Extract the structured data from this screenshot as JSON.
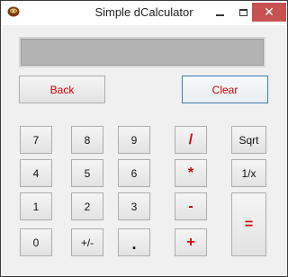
{
  "window": {
    "title": "Simple dCalculator",
    "close_glyph": "✕"
  },
  "display": {
    "value": ""
  },
  "top_buttons": {
    "back": "Back",
    "clear": "Clear"
  },
  "keypad": {
    "seven": "7",
    "eight": "8",
    "nine": "9",
    "four": "4",
    "five": "5",
    "six": "6",
    "one": "1",
    "two": "2",
    "three": "3",
    "zero": "0",
    "plus_minus": "+/-",
    "decimal": "."
  },
  "operators": {
    "divide": "/",
    "multiply": "*",
    "subtract": "-",
    "add": "+",
    "equals": "="
  },
  "functions": {
    "sqrt": "Sqrt",
    "reciprocal": "1/x"
  },
  "colors": {
    "accent_text": "#d10000",
    "display_bg": "#b3b3b3",
    "close_bg": "#c75050",
    "focus_border": "#3c7fb1"
  }
}
